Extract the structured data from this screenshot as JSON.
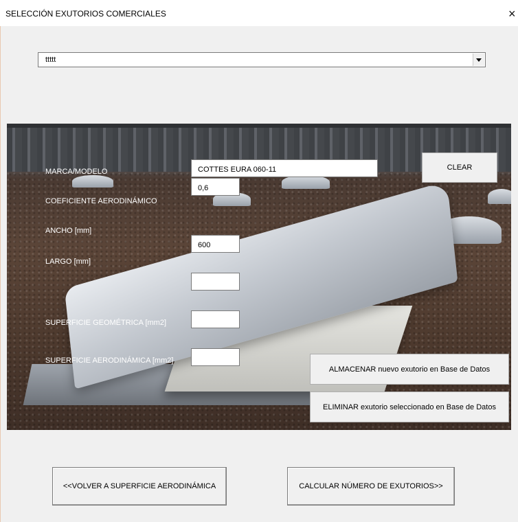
{
  "window": {
    "title": "SELECCIÓN EXUTORIOS COMERCIALES",
    "close_label": "×"
  },
  "combo": {
    "value": "ttttt",
    "dropdown_icon": "chevron-down-icon"
  },
  "fields": {
    "marca_label": "MARCA/MODELO",
    "marca_value": "COTTES EURA 060-11",
    "coef_label": "COEFICIENTE AERODINÁMICO",
    "coef_value": "0,6",
    "ancho_label": "ANCHO [mm]",
    "ancho_value": "600",
    "largo_label": "LARGO [mm]",
    "largo_value": "",
    "sup_geo_label": "SUPERFICIE GEOMÉTRICA [mm2]",
    "sup_geo_value": "",
    "sup_aero_label": "SUPERFICIE AERODINÁMICA [mm2]",
    "sup_aero_value": ""
  },
  "buttons": {
    "clear": "CLEAR",
    "almacenar": "ALMACENAR nuevo exutorio en Base de Datos",
    "eliminar": "ELIMINAR exutorio seleccionado en Base de Datos",
    "volver": "<<VOLVER A SUPERFICIE AERODINÁMICA",
    "calcular": "CALCULAR NÚMERO DE EXUTORIOS>>"
  },
  "colors": {
    "form_bg": "#f0f0f0",
    "label_text": "#ffffff"
  }
}
